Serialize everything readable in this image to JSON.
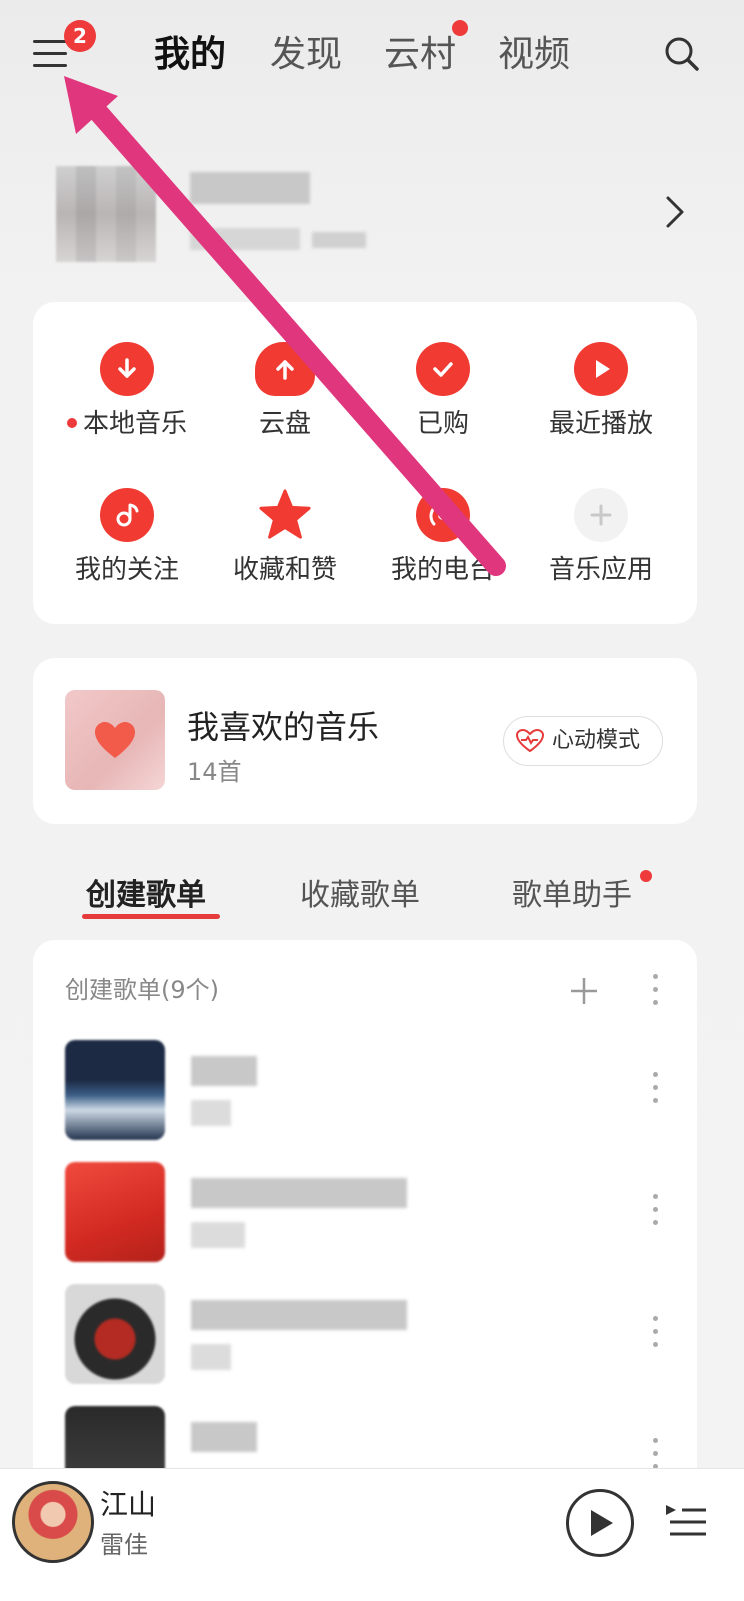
{
  "header": {
    "tabs": [
      {
        "label": "我的",
        "active": true
      },
      {
        "label": "发现",
        "active": false
      },
      {
        "label": "云村",
        "active": false,
        "dot": true
      },
      {
        "label": "视频",
        "active": false
      }
    ],
    "menu_badge": "2",
    "icons": {
      "menu": "menu-icon",
      "search": "search-icon"
    }
  },
  "quick_actions": [
    {
      "label": "本地音乐",
      "icon": "download-icon",
      "dot": true
    },
    {
      "label": "云盘",
      "icon": "cloud-upload-icon"
    },
    {
      "label": "已购",
      "icon": "check-icon"
    },
    {
      "label": "最近播放",
      "icon": "play-icon"
    },
    {
      "label": "我的关注",
      "icon": "music-note-icon"
    },
    {
      "label": "收藏和赞",
      "icon": "star-icon"
    },
    {
      "label": "我的电台",
      "icon": "radio-icon"
    },
    {
      "label": "音乐应用",
      "icon": "plus-icon"
    }
  ],
  "liked": {
    "title": "我喜欢的音乐",
    "count": "14首",
    "heart_mode": "心动模式"
  },
  "playlist_tabs": [
    {
      "label": "创建歌单",
      "active": true
    },
    {
      "label": "收藏歌单",
      "active": false
    },
    {
      "label": "歌单助手",
      "active": false,
      "dot": true
    }
  ],
  "created_list": {
    "header": "创建歌单(9个)"
  },
  "player": {
    "title": "江山",
    "artist": "雷佳"
  },
  "colors": {
    "accent": "#f03a32",
    "annotation_arrow": "#e0367d"
  }
}
